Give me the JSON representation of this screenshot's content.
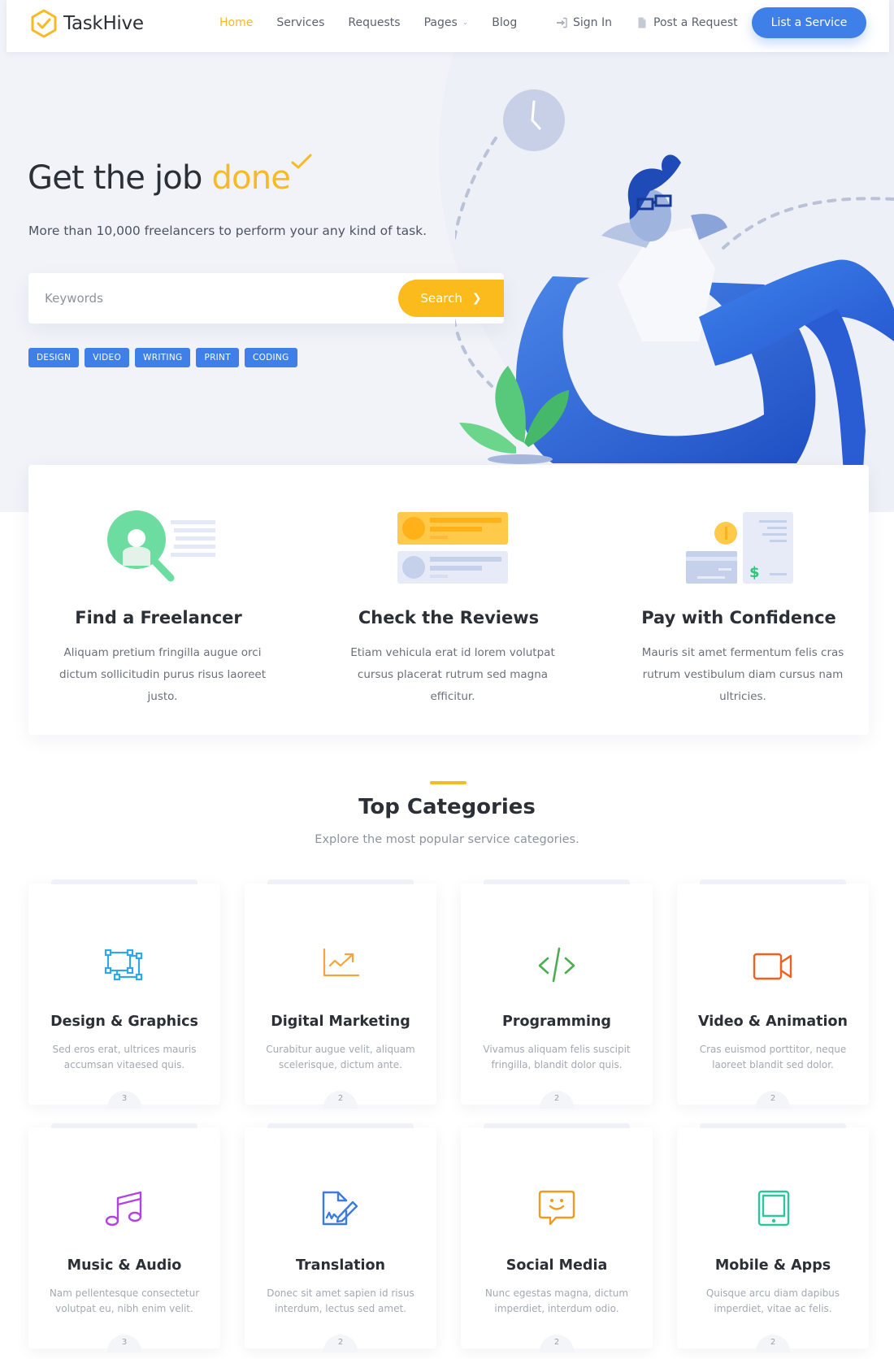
{
  "brand": {
    "name": "TaskHive",
    "accent": "#f7b924",
    "primary": "#3f7fe8"
  },
  "nav": {
    "links": [
      {
        "label": "Home",
        "active": true
      },
      {
        "label": "Services"
      },
      {
        "label": "Requests"
      },
      {
        "label": "Pages",
        "dropdown": true
      },
      {
        "label": "Blog"
      }
    ],
    "sign_in": {
      "label": "Sign In",
      "icon": "sign-in-icon"
    },
    "post_request": {
      "label": "Post a Request",
      "icon": "document-icon"
    },
    "cta": "List a Service"
  },
  "hero": {
    "title_main": "Get the job ",
    "title_accent": "done",
    "subtitle": "More than 10,000 freelancers to perform your any kind of task.",
    "search": {
      "placeholder": "Keywords",
      "value": "",
      "button": "Search"
    },
    "tags": [
      "DESIGN",
      "VIDEO",
      "WRITING",
      "PRINT",
      "CODING"
    ]
  },
  "steps": [
    {
      "title": "Find a Freelancer",
      "description": "Aliquam pretium fringilla augue orci dictum sollicitudin purus risus laoreet justo.",
      "icon": "find-freelancer-icon"
    },
    {
      "title": "Check the Reviews",
      "description": "Etiam vehicula erat id lorem volutpat cursus placerat rutrum sed magna efficitur.",
      "icon": "reviews-icon"
    },
    {
      "title": "Pay with Confidence",
      "description": "Mauris sit amet fermentum felis cras rutrum vestibulum diam cursus nam ultricies.",
      "icon": "payment-icon"
    }
  ],
  "categories_section": {
    "title": "Top Categories",
    "subtitle": "Explore the most popular service categories."
  },
  "categories": [
    {
      "title": "Design & Graphics",
      "description": "Sed eros erat, ultrices mauris accumsan vitaesed quis.",
      "count": "3",
      "icon": "vector-design-icon",
      "color": "#2ea8e8"
    },
    {
      "title": "Digital Marketing",
      "description": "Curabitur augue velit, aliquam scelerisque, dictum ante.",
      "count": "2",
      "icon": "chart-growth-icon",
      "color": "#f5a33a"
    },
    {
      "title": "Programming",
      "description": "Vivamus aliquam felis suscipit fringilla, blandit dolor quis.",
      "count": "2",
      "icon": "code-icon",
      "color": "#4cae4f"
    },
    {
      "title": "Video & Animation",
      "description": "Cras euismod porttitor, neque laoreet blandit sed dolor.",
      "count": "2",
      "icon": "video-camera-icon",
      "color": "#f0601f"
    },
    {
      "title": "Music & Audio",
      "description": "Nam pellentesque consectetur volutpat eu, nibh enim velit.",
      "count": "3",
      "icon": "music-note-icon",
      "color": "#b044e0"
    },
    {
      "title": "Translation",
      "description": "Donec sit amet sapien id risus interdum, lectus sed amet.",
      "count": "2",
      "icon": "document-sign-icon",
      "color": "#3d7be0"
    },
    {
      "title": "Social Media",
      "description": "Nunc egestas magna, dictum imperdiet, interdum odio.",
      "count": "2",
      "icon": "chat-smile-icon",
      "color": "#f39a1e"
    },
    {
      "title": "Mobile & Apps",
      "description": "Quisque arcu diam dapibus imperdiet, vitae ac felis.",
      "count": "2",
      "icon": "tablet-icon",
      "color": "#2ec4a0"
    }
  ]
}
